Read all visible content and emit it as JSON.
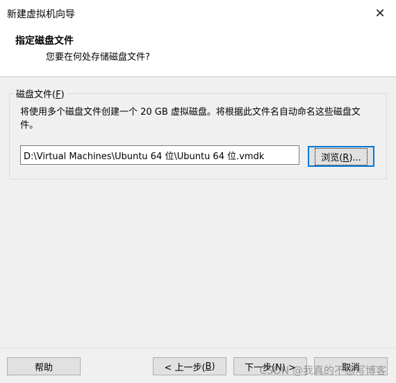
{
  "window": {
    "title": "新建虚拟机向导",
    "close_glyph": "✕"
  },
  "header": {
    "title": "指定磁盘文件",
    "subtitle": "您要在何处存储磁盘文件?"
  },
  "disk_file": {
    "group_label_pre": "磁盘文件(",
    "group_label_key": "F",
    "group_label_post": ")",
    "description": "将使用多个磁盘文件创建一个 20 GB 虚拟磁盘。将根据此文件名自动命名这些磁盘文件。",
    "path_value": "D:\\Virtual Machines\\Ubuntu 64 位\\Ubuntu 64 位.vmdk",
    "browse_pre": "浏览(",
    "browse_key": "R",
    "browse_post": ")..."
  },
  "footer": {
    "help_label": "帮助",
    "back_pre": "< 上一步(",
    "back_key": "B",
    "back_post": ")",
    "next_label": "下一步(N) >",
    "cancel_label": "取消"
  },
  "watermark": "CSDN @我真的不想写博客"
}
